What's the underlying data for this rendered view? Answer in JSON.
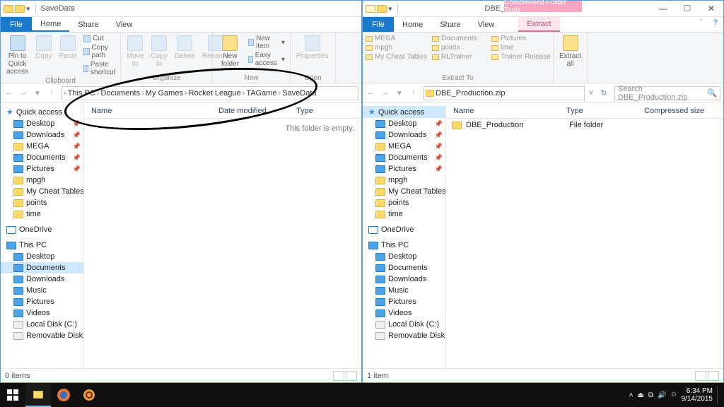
{
  "left": {
    "title": "SaveData",
    "tabs": {
      "file": "File",
      "home": "Home",
      "share": "Share",
      "view": "View"
    },
    "ribbon": {
      "clipboard": {
        "label": "Clipboard",
        "pin": "Pin to Quick access",
        "copy": "Copy",
        "paste": "Paste",
        "cut": "Cut",
        "copypath": "Copy path",
        "pasteshort": "Paste shortcut"
      },
      "organize": {
        "label": "Organize",
        "moveto": "Move to",
        "copyto": "Copy to",
        "delete": "Delete",
        "rename": "Rename"
      },
      "new": {
        "label": "New",
        "newfolder": "New folder",
        "newitem": "New item",
        "easy": "Easy access"
      },
      "open": {
        "label": "Open",
        "properties": "Properties"
      }
    },
    "breadcrumb": [
      "This PC",
      "Documents",
      "My Games",
      "Rocket League",
      "TAGame",
      "SaveData"
    ],
    "cols": {
      "name": "Name",
      "date": "Date modified",
      "type": "Type"
    },
    "empty": "This folder is empty.",
    "status": "0 items"
  },
  "right": {
    "context_tab": "Compressed Folder Tools",
    "title": "DBE_Production.zip",
    "tabs": {
      "file": "File",
      "home": "Home",
      "share": "Share",
      "view": "View",
      "extract": "Extract"
    },
    "ribbon": {
      "extract_to_label": "Extract To",
      "dests": [
        "MEGA",
        "Documents",
        "Pictures",
        "mpgh",
        "points",
        "time",
        "My Cheat Tables",
        "RLTrainer",
        "Trainer Release"
      ],
      "extract_all": "Extract all"
    },
    "addr": "DBE_Production.zip",
    "search_placeholder": "Search DBE_Production.zip",
    "cols": {
      "name": "Name",
      "type": "Type",
      "csize": "Compressed size"
    },
    "item": {
      "name": "DBE_Production",
      "type": "File folder"
    },
    "status": "1 item"
  },
  "sidebar": {
    "quick": "Quick access",
    "items": [
      "Desktop",
      "Downloads",
      "MEGA",
      "Documents",
      "Pictures",
      "mpgh",
      "My Cheat Tables",
      "points",
      "time"
    ],
    "onedrive": "OneDrive",
    "thispc": "This PC",
    "pc_items": [
      "Desktop",
      "Documents",
      "Downloads",
      "Music",
      "Pictures",
      "Videos",
      "Local Disk (C:)",
      "Removable Disk"
    ]
  },
  "taskbar": {
    "time": "6:34 PM",
    "date": "9/14/2015"
  }
}
